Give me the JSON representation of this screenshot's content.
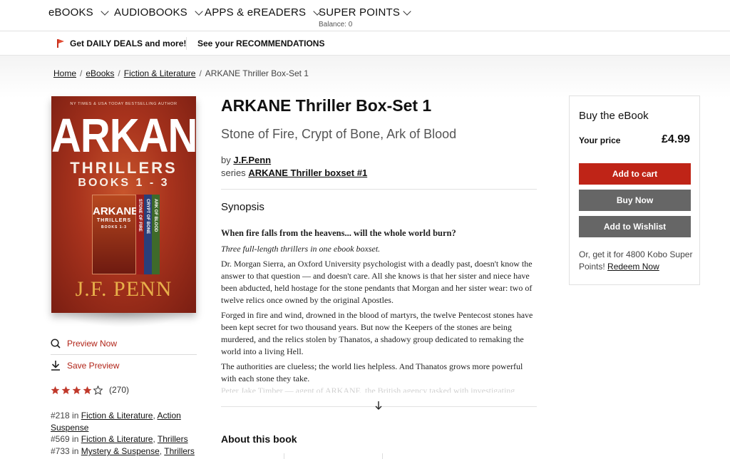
{
  "nav": {
    "items": [
      {
        "label": "eBOOKS"
      },
      {
        "label": "AUDIOBOOKS"
      },
      {
        "label": "APPS & eREADERS"
      },
      {
        "label": "SUPER POINTS"
      }
    ],
    "balance": "Balance: 0"
  },
  "promo": {
    "deals": "Get DAILY DEALS and more!",
    "recommendations": "See your RECOMMENDATIONS"
  },
  "breadcrumb": {
    "items": [
      "Home",
      "eBooks",
      "Fiction & Literature"
    ],
    "current": "ARKANE Thriller Box-Set 1"
  },
  "cover": {
    "tagline": "NY TIMES & USA TODAY BESTSELLING AUTHOR",
    "brand": "ARKANE",
    "line1": "THRILLERS",
    "line2": "BOOKS 1 - 3",
    "box_brand": "ARKANE",
    "box_sub": "THRILLERS",
    "box_sub2": "BOOKS 1-3",
    "spines": [
      "STONE OF FIRE",
      "CRYPT OF BONE",
      "ARK OF BLOOD"
    ],
    "author": "J.F. PENN"
  },
  "left": {
    "preview_now": "Preview Now",
    "save_preview": "Save Preview",
    "rating": 4,
    "rating_max": 5,
    "rating_count": "(270)",
    "ranks": [
      {
        "rank": "#218",
        "in": "in",
        "cats": [
          "Fiction & Literature",
          "Action Suspense"
        ]
      },
      {
        "rank": "#569",
        "in": "in",
        "cats": [
          "Fiction & Literature",
          "Thrillers"
        ]
      },
      {
        "rank": "#733",
        "in": "in",
        "cats": [
          "Mystery & Suspense",
          "Thrillers"
        ]
      }
    ]
  },
  "book": {
    "title": "ARKANE Thriller Box-Set 1",
    "subtitle": "Stone of Fire, Crypt of Bone, Ark of Blood",
    "by_label": "by",
    "author": "J.F.Penn",
    "series_label": "series",
    "series": "ARKANE Thriller boxset #1"
  },
  "synopsis": {
    "heading": "Synopsis",
    "headline": "When fire falls from the heavens... will the whole world burn?",
    "tagline": "Three full-length thrillers in one ebook boxset.",
    "p1": "Dr. Morgan Sierra, an Oxford University psychologist with a deadly past, doesn't know the answer to that question — and doesn't care. All she knows is that her sister and niece have been abducted, held hostage for the stone pendants that Morgan and her sister wear: two of twelve relics once owned by the original Apostles.",
    "p2": "Forged in fire and wind, drowned in the blood of martyrs, the twelve Pentecost stones have been kept secret for two thousand years. But now the Keepers of the stones are being murdered, and the relics stolen by Thanatos, a shadowy group dedicated to remaking the world into a living Hell.",
    "p3": "The authorities are clueless; the world lies helpless. And Thanatos grows more powerful with each stone they take.",
    "p4_faded": "Peter Jake Timber — agent of ARKANE, the British agency tasked with investigating"
  },
  "about": {
    "heading": "About this book"
  },
  "buy": {
    "heading": "Buy the eBook",
    "price_label": "Your price",
    "price": "£4.99",
    "add_to_cart": "Add to cart",
    "buy_now": "Buy Now",
    "add_to_wishlist": "Add to Wishlist",
    "kobo_text": "Or, get it for 4800 Kobo Super Points!",
    "redeem": "Redeem Now"
  },
  "colors": {
    "accent_red": "#bf2417",
    "button_grey": "#666666",
    "star": "#c0392b"
  }
}
